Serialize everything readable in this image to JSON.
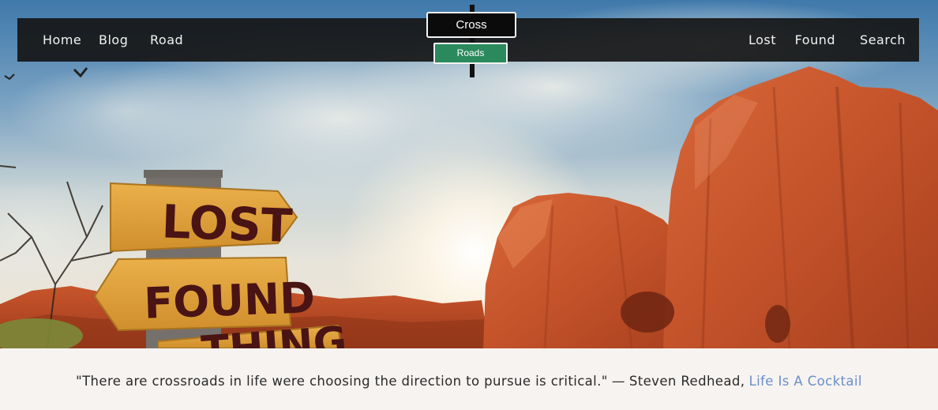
{
  "nav": {
    "left": [
      "Home",
      "Blog",
      "Road"
    ],
    "right": [
      "Lost",
      "Found",
      "Search"
    ]
  },
  "logo": {
    "top": "Cross",
    "bottom": "Roads"
  },
  "signs": {
    "first": "LOST",
    "second": "FOUND",
    "third": "THING"
  },
  "quote": {
    "text": "\"There are crossroads in life were choosing the direction to pursue is critical.\"",
    "dash": "—",
    "author": "Steven Redhead,",
    "book": "Life Is A Cocktail"
  },
  "colors": {
    "navbar": "#161616",
    "logo_green": "#2a8a5d",
    "link": "#6a8fc7",
    "rock": "#c85a2e",
    "sign": "#e0a23a"
  }
}
